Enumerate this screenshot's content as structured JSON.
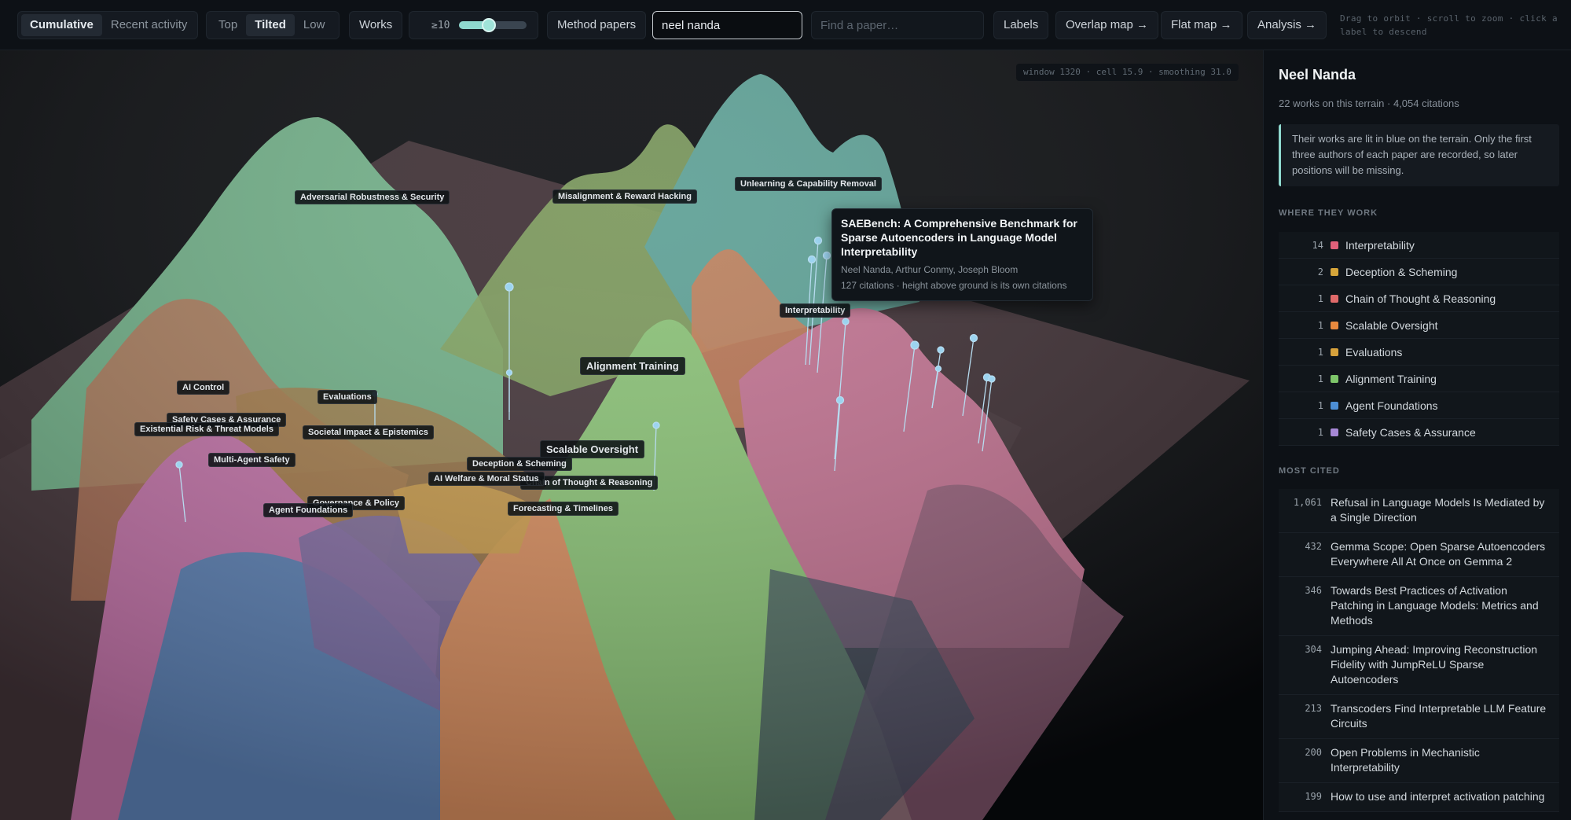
{
  "toolbar": {
    "mode_tabs": [
      "Cumulative",
      "Recent activity"
    ],
    "mode_active": 0,
    "view_tabs": [
      "Top",
      "Tilted",
      "Low"
    ],
    "view_active": 1,
    "works_label": "Works",
    "threshold_label": "≥10",
    "slider_fraction": 0.44,
    "method_papers_label": "Method papers",
    "author_query": "neel nanda",
    "paper_search_placeholder": "Find a paper…",
    "labels_label": "Labels",
    "overlap_map_label": "Overlap map →",
    "flat_map_label": "Flat map →",
    "analysis_label": "Analysis →",
    "hint": "Drag to orbit · scroll to zoom · click a label to descend"
  },
  "terrain": {
    "status": "window 1320 · cell 15.9 · smoothing 31.0",
    "labels": [
      "Adversarial Robustness & Security",
      "Misalignment & Reward Hacking",
      "Unlearning & Capability Removal",
      "Interpretability",
      "Alignment Training",
      "AI Control",
      "Evaluations",
      "Safety Cases & Assurance",
      "Existential Risk & Threat Models",
      "Societal Impact & Epistemics",
      "Multi-Agent Safety",
      "Scalable Oversight",
      "Deception & Scheming",
      "AI Welfare & Moral Status",
      "Chain of Thought & Reasoning",
      "Governance & Policy",
      "Agent Foundations",
      "Forecasting & Timelines"
    ]
  },
  "tooltip": {
    "title": "SAEBench: A Comprehensive Benchmark for Sparse Autoencoders in Language Model Interpretability",
    "authors": "Neel Nanda, Arthur Conmy, Joseph Bloom",
    "meta": "127 citations · height above ground is its own citations"
  },
  "panel": {
    "name": "Neel Nanda",
    "stats": "22 works on this terrain · 4,054 citations",
    "note": "Their works are lit in blue on the terrain. Only the first three authors of each paper are recorded, so later positions will be missing.",
    "where_heading": "WHERE THEY WORK",
    "where": [
      {
        "count": "14",
        "label": "Interpretability",
        "color": "#e0607a"
      },
      {
        "count": "2",
        "label": "Deception & Scheming",
        "color": "#d6a53a"
      },
      {
        "count": "1",
        "label": "Chain of Thought & Reasoning",
        "color": "#e06a6a"
      },
      {
        "count": "1",
        "label": "Scalable Oversight",
        "color": "#e8893e"
      },
      {
        "count": "1",
        "label": "Evaluations",
        "color": "#d7a23c"
      },
      {
        "count": "1",
        "label": "Alignment Training",
        "color": "#7ec66a"
      },
      {
        "count": "1",
        "label": "Agent Foundations",
        "color": "#4d8fd6"
      },
      {
        "count": "1",
        "label": "Safety Cases & Assurance",
        "color": "#a788d6"
      }
    ],
    "cited_heading": "MOST CITED",
    "cited": [
      {
        "count": "1,061",
        "title": "Refusal in Language Models Is Mediated by a Single Direction"
      },
      {
        "count": "432",
        "title": "Gemma Scope: Open Sparse Autoencoders Everywhere All At Once on Gemma 2"
      },
      {
        "count": "346",
        "title": "Towards Best Practices of Activation Patching in Language Models: Metrics and Methods"
      },
      {
        "count": "304",
        "title": "Jumping Ahead: Improving Reconstruction Fidelity with JumpReLU Sparse Autoencoders"
      },
      {
        "count": "213",
        "title": "Transcoders Find Interpretable LLM Feature Circuits"
      },
      {
        "count": "200",
        "title": "Open Problems in Mechanistic Interpretability"
      },
      {
        "count": "199",
        "title": "How to use and interpret activation patching"
      }
    ]
  }
}
